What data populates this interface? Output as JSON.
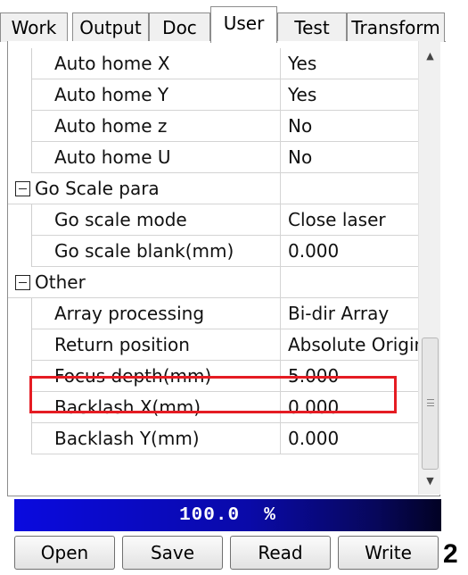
{
  "tabs": [
    {
      "label": "Work",
      "active": false
    },
    {
      "label": "Output",
      "active": false
    },
    {
      "label": "Doc",
      "active": false
    },
    {
      "label": "User",
      "active": true
    },
    {
      "label": "Test",
      "active": false
    },
    {
      "label": "Transform",
      "active": false
    }
  ],
  "grid": {
    "rows": [
      {
        "type": "item",
        "name": "Auto home X",
        "value": "Yes"
      },
      {
        "type": "item",
        "name": "Auto home Y",
        "value": "Yes"
      },
      {
        "type": "item",
        "name": "Auto home z",
        "value": "No"
      },
      {
        "type": "item",
        "name": "Auto home U",
        "value": "No"
      },
      {
        "type": "group",
        "name": "Go Scale para",
        "value": ""
      },
      {
        "type": "item",
        "name": "Go scale mode",
        "value": "Close laser"
      },
      {
        "type": "item",
        "name": "Go scale blank(mm)",
        "value": "0.000"
      },
      {
        "type": "group",
        "name": "Other",
        "value": ""
      },
      {
        "type": "item",
        "name": "Array processing",
        "value": "Bi-dir Array"
      },
      {
        "type": "item",
        "name": "Return position",
        "value": "Absolute Origin"
      },
      {
        "type": "item",
        "name": "Focus depth(mm)",
        "value": "5.000",
        "highlighted": true
      },
      {
        "type": "item",
        "name": "Backlash X(mm)",
        "value": "0.000"
      },
      {
        "type": "item",
        "name": "Backlash Y(mm)",
        "value": "0.000"
      }
    ]
  },
  "progress": {
    "text": "100.0  %",
    "fraction": 1.0
  },
  "buttons": {
    "open": "Open",
    "save": "Save",
    "read": "Read",
    "write": "Write"
  },
  "side_number": "2",
  "colors": {
    "highlight_border": "#e51c23",
    "progress_start": "#0a0adf",
    "progress_end": "#020224"
  }
}
